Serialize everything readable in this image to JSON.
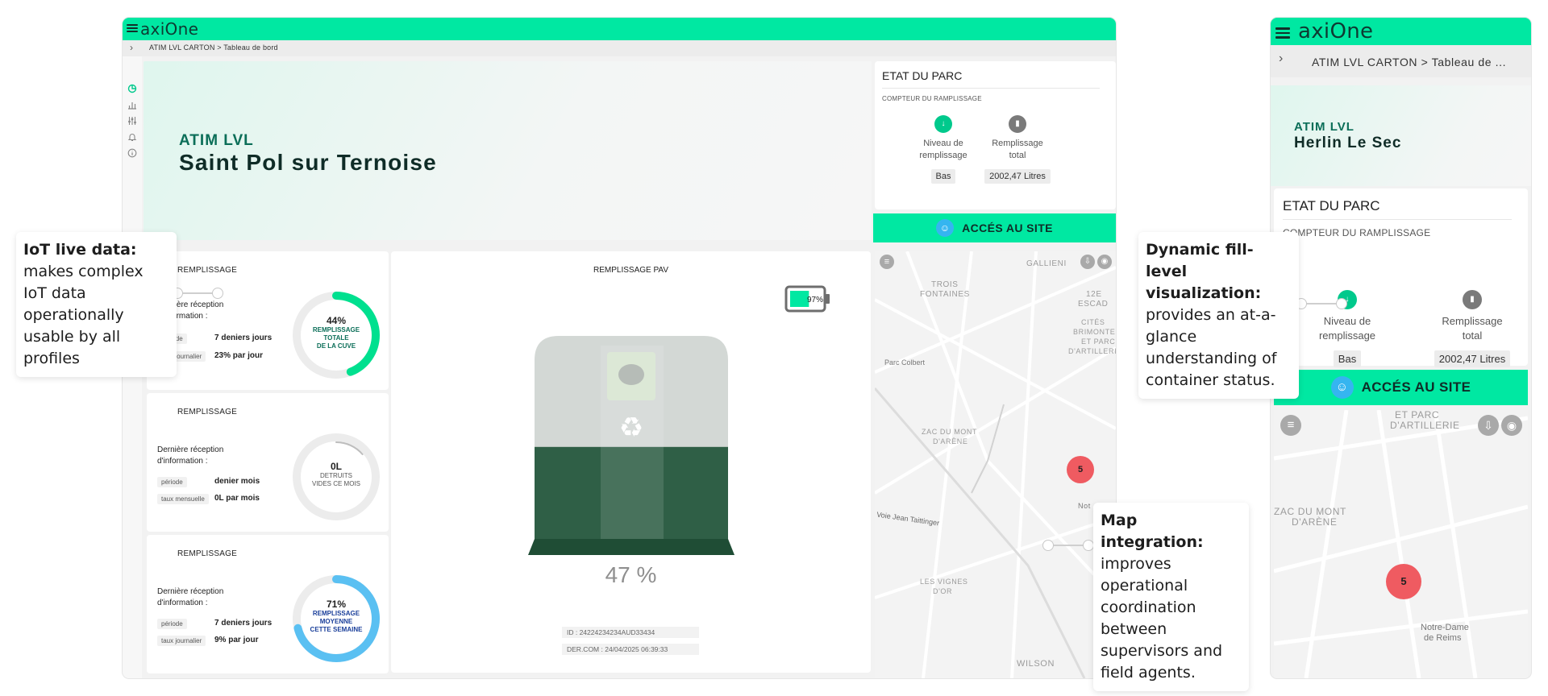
{
  "desktop": {
    "logo": "axiOne",
    "breadcrumb": "ATIM LVL CARTON > Tableau de bord",
    "hero": {
      "subtitle": "ATIM LVL",
      "title": "Saint Pol sur Ternoise"
    },
    "etat": {
      "title": "ETAT DU PARC",
      "counter_label": "COMPTEUR DU RAMPLISSAGE",
      "level_caption_1": "Niveau de",
      "level_caption_2": "remplissage",
      "level_value": "Bas",
      "total_caption_1": "Remplissage",
      "total_caption_2": "total",
      "total_value": "2002,47 Litres"
    },
    "access_label": "ACCÉS AU SITE",
    "cards": [
      {
        "title": "REMPLISSAGE",
        "reception_1": "Dernière réception",
        "reception_2": "d'information :",
        "k1": "période",
        "v1": "7 deniers jours",
        "k2": "taux journalier",
        "v2": "23% par jour",
        "ring_value": "44%",
        "ring_l1": "REMPLISSAGE",
        "ring_l2": "TOTALE",
        "ring_l3": "DE LA CUVE",
        "fill": 0.44,
        "color": "#00e08f",
        "text_color": "#0b6e58"
      },
      {
        "title": "REMPLISSAGE",
        "reception_1": "Dernière réception",
        "reception_2": "d'information :",
        "k1": "période",
        "v1": "denier mois",
        "k2": "taux mensuelle",
        "v2": "0L par mois",
        "ring_value": "0L",
        "ring_l1": "DETRUITS",
        "ring_l2": "VIDES CE MOIS",
        "ring_l3": "",
        "fill": 0,
        "color": "#bdbdbd",
        "text_color": "#555555"
      },
      {
        "title": "REMPLISSAGE",
        "reception_1": "Dernière réception",
        "reception_2": "d'information :",
        "k1": "période",
        "v1": "7 deniers jours",
        "k2": "taux journalier",
        "v2": "9% par jour",
        "ring_value": "71%",
        "ring_l1": "REMPLISSAGE",
        "ring_l2": "MOYENNE",
        "ring_l3": "CETTE SEMAINE",
        "fill": 0.71,
        "color": "#5ac0f2",
        "text_color": "#1a3f9a"
      }
    ],
    "pav": {
      "title": "REMPLISSAGE PAV",
      "battery": "97%",
      "battery_level": 0.97,
      "fill_level": 0.47,
      "percent": "47 %",
      "id": "ID : 24224234234AUD33434",
      "dercom": "DER.COM : 24/04/2025 06:39:33"
    },
    "map": {
      "labels": [
        "GALLIENI",
        "TROIS",
        "FONTAINES",
        "12E",
        "ESCAD",
        "CITÉS",
        "BRIMONTEL",
        "ET PARC",
        "D'ARTILLERI",
        "Parc Colbert",
        "ZAC DU MONT",
        "D'ARÈNE",
        "Voie Jean Taittinger",
        "Not",
        "LES VIGNES",
        "D'OR",
        "WILSON"
      ],
      "cluster": "5"
    }
  },
  "mobile": {
    "logo": "axiOne",
    "breadcrumb": "ATIM LVL CARTON > Tableau de ...",
    "hero": {
      "subtitle": "ATIM LVL",
      "title": "Herlin Le Sec"
    },
    "etat": {
      "title": "ETAT DU PARC",
      "counter_label": "COMPTEUR DU RAMPLISSAGE",
      "level_caption_1": "Niveau de",
      "level_caption_2": "remplissage",
      "level_value": "Bas",
      "total_caption_1": "Remplissage",
      "total_caption_2": "total",
      "total_value": "2002,47 Litres"
    },
    "access_label": "ACCÉS AU SITE",
    "map": {
      "labels": [
        "ET PARC",
        "D'ARTILLERIE",
        "ZAC DU MONT",
        "D'ARÈNE",
        "Notre-Dame",
        "de Reims"
      ],
      "cluster": "5"
    }
  },
  "callouts": {
    "iot_title": "IoT live data:",
    "iot_body": "makes complex IoT data operationally usable by all profiles",
    "fill_title": "Dynamic fill-level visualization:",
    "fill_body": "provides an at-a-glance understanding of container status.",
    "map_title": "Map integration:",
    "map_body": "improves operational coordination between supervisors and field agents."
  }
}
